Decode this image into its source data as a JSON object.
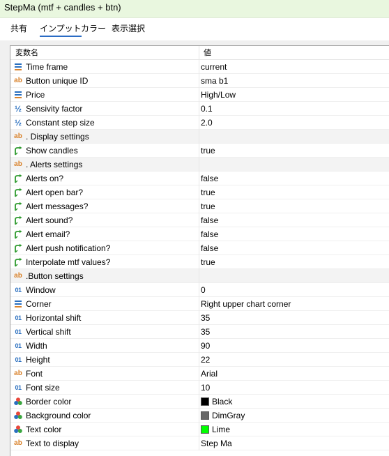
{
  "window": {
    "title": "StepMa (mtf + candles + btn)"
  },
  "tabs": [
    {
      "label": "共有"
    },
    {
      "label": "インプット"
    },
    {
      "label": "カラー"
    },
    {
      "label": "表示選択"
    }
  ],
  "grid": {
    "headers": {
      "name": "変数名",
      "value": "値"
    },
    "rows": [
      {
        "name": "Time frame",
        "value": "current",
        "icon": "enum-icon"
      },
      {
        "name": "Button unique ID",
        "value": "sma b1",
        "icon": "string-icon"
      },
      {
        "name": "Price",
        "value": "High/Low",
        "icon": "enum-icon"
      },
      {
        "name": "Sensivity factor",
        "value": "0.1",
        "icon": "fraction-icon"
      },
      {
        "name": "Constant step size",
        "value": "2.0",
        "icon": "fraction-icon"
      },
      {
        "name": ".  Display settings",
        "value": "",
        "icon": "string-icon"
      },
      {
        "name": "Show candles",
        "value": "true",
        "icon": "bool-icon"
      },
      {
        "name": ".  Alerts settings",
        "value": "",
        "icon": "string-icon"
      },
      {
        "name": "Alerts on?",
        "value": "false",
        "icon": "bool-icon"
      },
      {
        "name": "Alert open bar?",
        "value": "true",
        "icon": "bool-icon"
      },
      {
        "name": "Alert messages?",
        "value": "true",
        "icon": "bool-icon"
      },
      {
        "name": "Alert sound?",
        "value": "false",
        "icon": "bool-icon"
      },
      {
        "name": "Alert email?",
        "value": "false",
        "icon": "bool-icon"
      },
      {
        "name": "Alert push notification?",
        "value": "false",
        "icon": "bool-icon"
      },
      {
        "name": "Interpolate mtf values?",
        "value": "true",
        "icon": "bool-icon"
      },
      {
        "name": ".Button settings",
        "value": "",
        "icon": "string-icon"
      },
      {
        "name": "Window",
        "value": "0",
        "icon": "integer-icon"
      },
      {
        "name": "Corner",
        "value": "Right upper chart corner",
        "icon": "enum-icon"
      },
      {
        "name": "Horizontal shift",
        "value": "35",
        "icon": "integer-icon"
      },
      {
        "name": "Vertical shift",
        "value": "35",
        "icon": "integer-icon"
      },
      {
        "name": "Width",
        "value": "90",
        "icon": "integer-icon"
      },
      {
        "name": "Height",
        "value": "22",
        "icon": "integer-icon"
      },
      {
        "name": "Font",
        "value": "Arial",
        "icon": "string-icon"
      },
      {
        "name": "Font size",
        "value": "10",
        "icon": "integer-icon"
      },
      {
        "name": "Border color",
        "value": "Black",
        "icon": "color-icon",
        "color": "#000000"
      },
      {
        "name": "Background color",
        "value": "DimGray",
        "icon": "color-icon",
        "color": "#696969"
      },
      {
        "name": "Text color",
        "value": "Lime",
        "icon": "color-icon",
        "color": "#00ff00"
      },
      {
        "name": "Text to display",
        "value": "Step Ma",
        "icon": "string-icon"
      }
    ]
  }
}
